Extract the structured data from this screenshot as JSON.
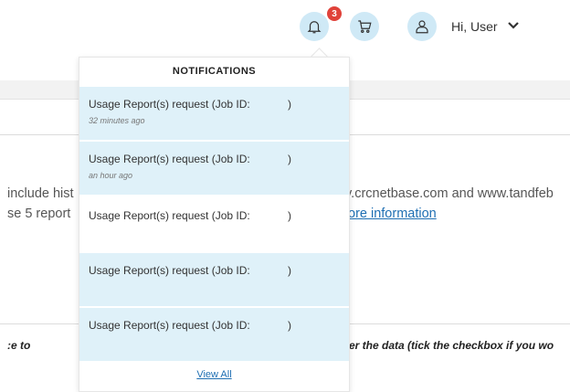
{
  "header": {
    "badge_count": "3",
    "greeting": "Hi, User"
  },
  "background": {
    "line1_left": "include hist",
    "line1_right": "v.crcnetbase.com and www.tandfeb",
    "line2_left": "se 5 report",
    "line2_link": "ore information",
    "bottom_left": ":e to",
    "bottom_right": "er the data (tick the checkbox if you wo"
  },
  "notifications": {
    "title": "NOTIFICATIONS",
    "items": [
      {
        "message": "Usage Report(s) request (Job ID:",
        "paren": ")",
        "time": "32 minutes ago"
      },
      {
        "message": "Usage Report(s) request (Job ID:",
        "paren": ")",
        "time": "an hour ago"
      },
      {
        "message": "Usage Report(s) request (Job ID:",
        "paren": ")",
        "time": ""
      },
      {
        "message": "Usage Report(s) request (Job ID:",
        "paren": ")",
        "time": ""
      },
      {
        "message": "Usage Report(s) request (Job ID:",
        "paren": ")",
        "time": ""
      }
    ],
    "view_all": "View All"
  }
}
